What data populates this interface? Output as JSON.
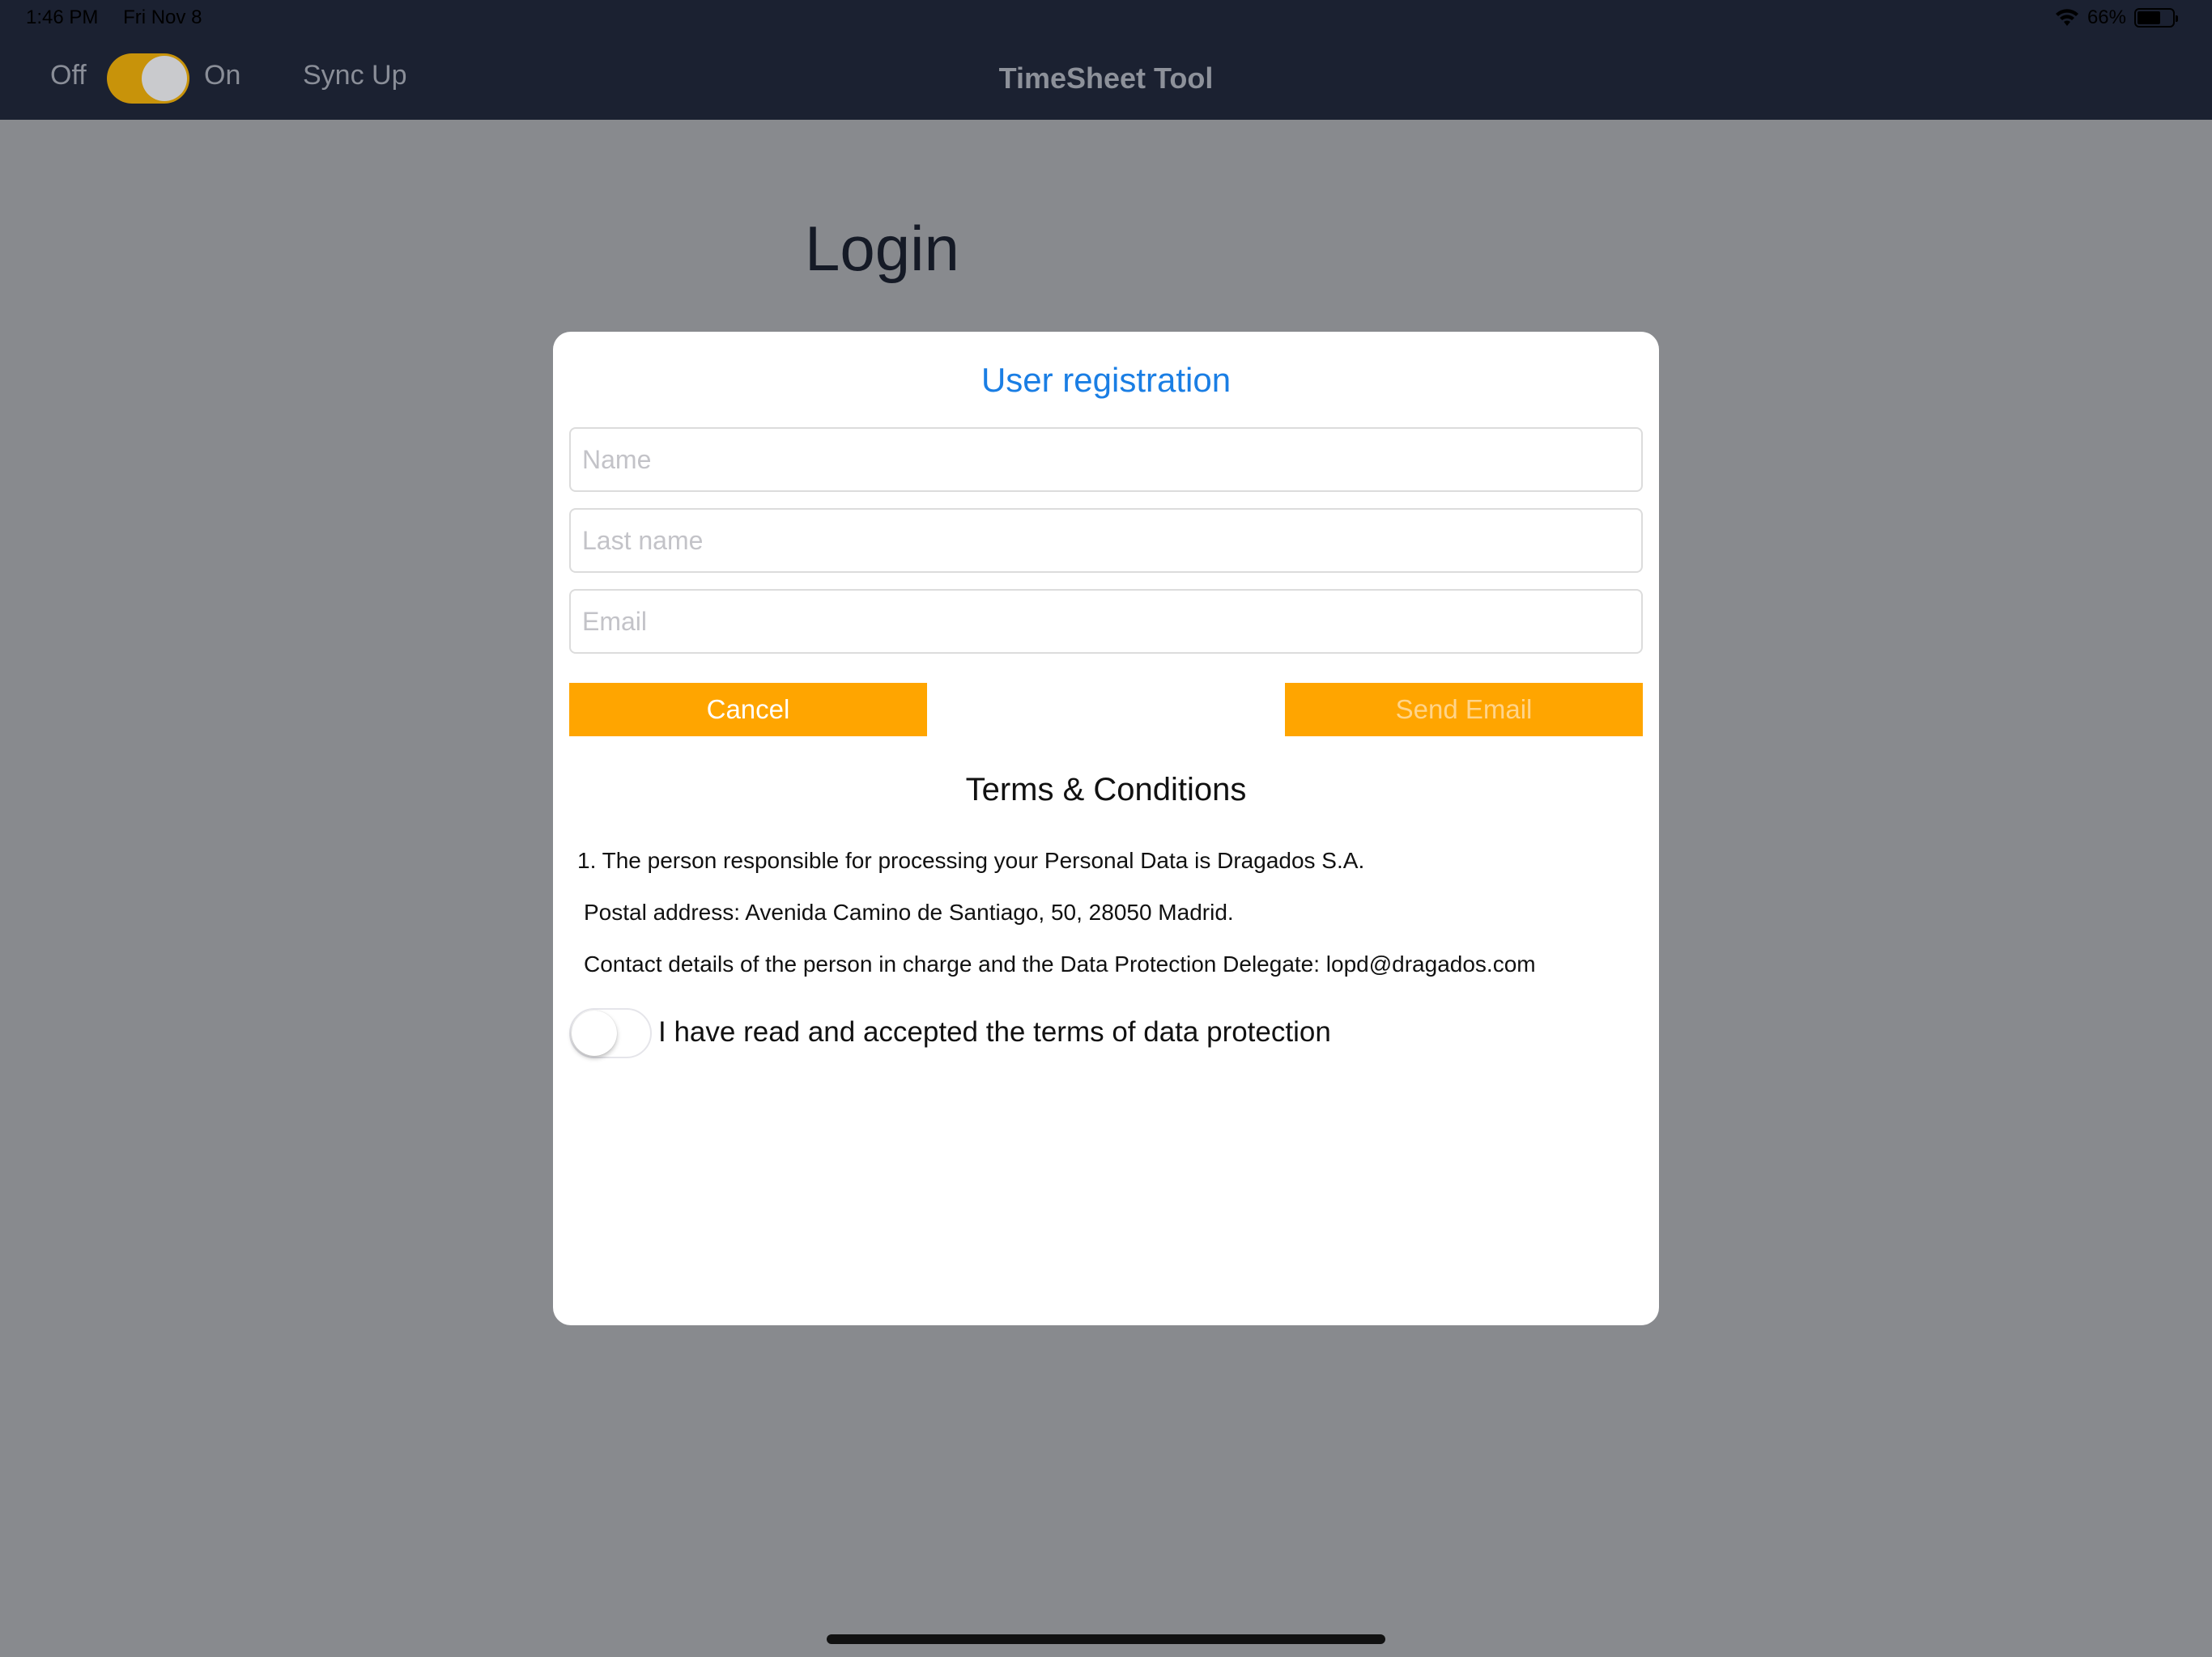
{
  "status_bar": {
    "time": "1:46 PM",
    "date": "Fri Nov 8",
    "battery": "66%",
    "battery_level": 0.66
  },
  "nav": {
    "off_label": "Off",
    "on_label": "On",
    "toggle_state": "on",
    "sync_label": "Sync Up",
    "title": "TimeSheet Tool"
  },
  "page": {
    "heading": "Login"
  },
  "modal": {
    "title": "User registration",
    "name_placeholder": "Name",
    "last_name_placeholder": "Last name",
    "email_placeholder": "Email",
    "cancel_label": "Cancel",
    "send_label": "Send Email",
    "terms_title": "Terms & Conditions",
    "terms": [
      "1. The person responsible for processing your Personal Data is Dragados S.A.",
      "Postal address: Avenida Camino de Santiago, 50, 28050 Madrid.",
      "Contact details of the person in charge and the Data Protection Delegate: lopd@dragados.com"
    ],
    "accept_label": "I have read and accepted the terms of data protection",
    "accept_state": "off"
  },
  "colors": {
    "accent_blue": "#1a7ee4",
    "button_orange": "#ffa500",
    "nav_background": "#1b2131",
    "overlay_gray": "#888a8e"
  }
}
